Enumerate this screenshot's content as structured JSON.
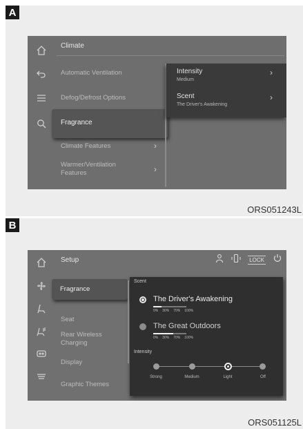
{
  "panel_a": {
    "letter": "A",
    "figure_code": "ORS051243L",
    "header_title": "Climate",
    "rail_icons": [
      "home-icon",
      "back-icon",
      "menu-icon",
      "search-icon"
    ],
    "menu": {
      "automatic_ventilation": "Automatic Ventilation",
      "defog_defrost": "Defog/Defrost Options",
      "fragrance": "Fragrance",
      "climate_features": "Climate Features",
      "warmer_line1": "Warmer/Ventilation",
      "warmer_line2": "Features"
    },
    "submenu": {
      "intensity_label": "Intensity",
      "intensity_value": "Medium",
      "scent_label": "Scent",
      "scent_value": "The Driver's Awakening"
    },
    "chevron": "›"
  },
  "panel_b": {
    "letter": "B",
    "figure_code": "ORS051125L",
    "header_title": "Setup",
    "lock_label": "LOCK",
    "rail_icons": [
      "home-icon",
      "fan-icon",
      "seat-icon",
      "seat-heat-icon",
      "camera-icon",
      "defrost-icon"
    ],
    "menu": {
      "fragrance": "Fragrance",
      "seat": "Seat",
      "rear_wireless_line1": "Rear Wireless",
      "rear_wireless_line2": "Charging",
      "display": "Display",
      "graphic_themes": "Graphic Themes"
    },
    "scent_section": "Scent",
    "scents": [
      {
        "name": "The Driver's Awakening",
        "selected": true,
        "remaining": 0.25,
        "ticks": [
          "0%",
          "30%",
          "70%",
          "100%"
        ]
      },
      {
        "name": "The Great Outdoors",
        "selected": false,
        "remaining": 0.6,
        "ticks": [
          "0%",
          "30%",
          "70%",
          "100%"
        ]
      }
    ],
    "intensity_section": "Intensity",
    "intensity_levels": [
      "Strong",
      "Medium",
      "Light",
      "Off"
    ],
    "intensity_selected": "Light"
  }
}
